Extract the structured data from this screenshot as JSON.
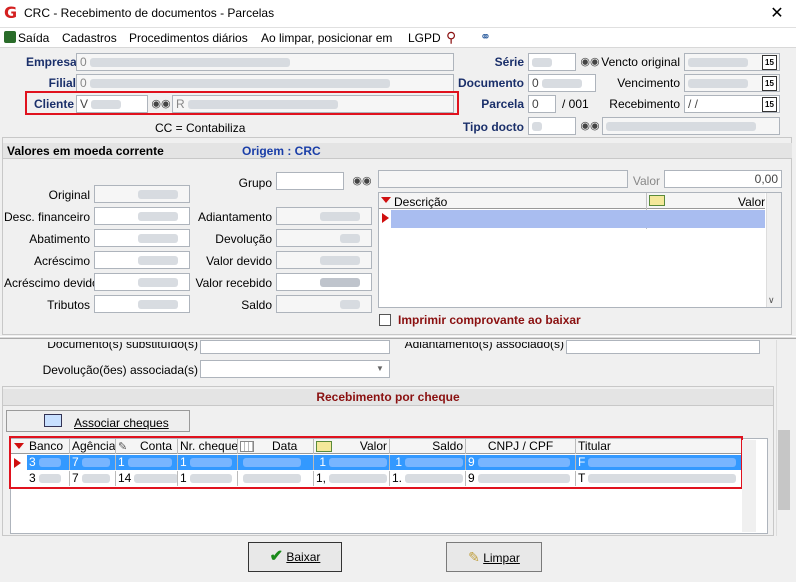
{
  "window": {
    "title": "CRC - Recebimento de documentos - Parcelas",
    "close": "✕"
  },
  "menu": [
    "Saída",
    "Cadastros",
    "Procedimentos diários",
    "Ao limpar, posicionar em",
    "LGPD"
  ],
  "header": {
    "empresa_label": "Empresa",
    "empresa_code": "0",
    "filial_label": "Filial",
    "filial_code": "0",
    "cliente_label": "Cliente",
    "cliente_code": "V",
    "cliente_name": "R",
    "cc_note": "CC = Contabiliza",
    "serie_label": "Série",
    "documento_label": "Documento",
    "documento_value": "0",
    "parcela_label": "Parcela",
    "parcela_value": "0",
    "parcela_total": "/ 001",
    "tipo_docto_label": "Tipo docto",
    "vencto_original_label": "Vencto original",
    "vencimento_label": "Vencimento",
    "recebimento_label": "Recebimento",
    "recebimento_value": " / /",
    "cal_text": "15"
  },
  "valores": {
    "title": "Valores em moeda corrente",
    "origem": "Origem : CRC",
    "original": "Original",
    "desc_financeiro": "Desc. financeiro",
    "abatimento": "Abatimento",
    "acrescimo": "Acréscimo",
    "acrescimo_devido": "Acréscimo devido",
    "tributos": "Tributos",
    "grupo": "Grupo",
    "adiantamento": "Adiantamento",
    "devolucao": "Devolução",
    "valor_devido": "Valor devido",
    "valor_recebido": "Valor recebido",
    "saldo": "Saldo",
    "valor_label": "Valor",
    "valor_value": "0,00",
    "desc_col": "Descrição",
    "valor_col": "Valor",
    "imprimir": "Imprimir comprovante ao baixar"
  },
  "assoc": {
    "doc_substituido": "Documento(s) substituído(s)",
    "adiantamento_assoc": "Adiantamento(s) associado(s)",
    "devolucao_assoc": "Devolução(ões) associada(s)"
  },
  "cheques": {
    "title": "Recebimento por cheque",
    "associar": "Associar cheques",
    "columns": [
      "Banco",
      "Agência",
      "Conta",
      "Nr. cheque",
      "Data",
      "Valor",
      "Saldo",
      "CNPJ / CPF",
      "Titular"
    ],
    "rows": [
      [
        "3",
        "7",
        "1",
        "1",
        "",
        "1",
        "1",
        "9",
        "F"
      ],
      [
        "3",
        "7",
        "14",
        "1",
        "",
        "1,",
        "1.",
        "9",
        "T"
      ]
    ]
  },
  "footer": {
    "baixar": "Baixar",
    "limpar": "Limpar"
  },
  "colors": {
    "accent": "#1a2f6a",
    "highlight": "#e0121e",
    "selected_row": "#3399ff"
  }
}
